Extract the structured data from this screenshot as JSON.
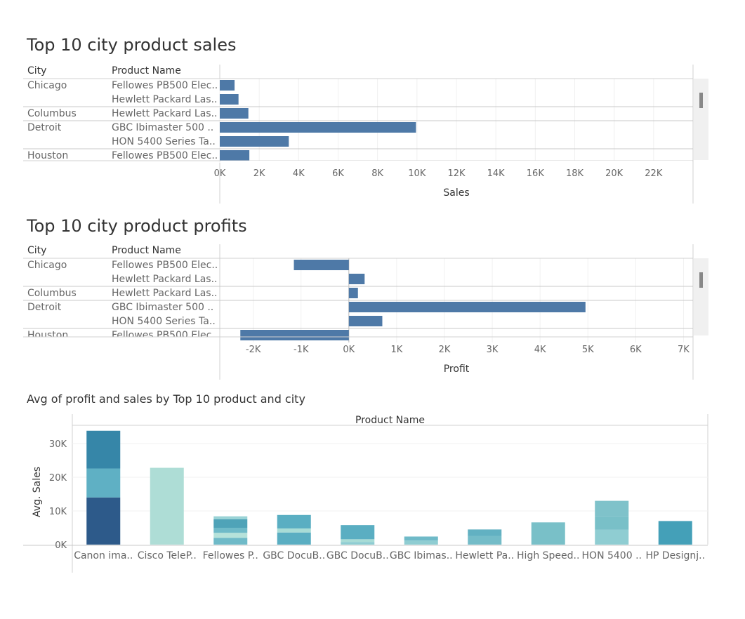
{
  "sales_panel": {
    "title": "Top 10 city product sales",
    "col_city": "City",
    "col_product": "Product Name"
  },
  "profit_panel": {
    "title": "Top 10 city product profits",
    "col_city": "City",
    "col_product": "Product Name"
  },
  "avg_panel": {
    "title": "Avg of profit and sales by Top 10 product and city",
    "header": "Product Name"
  },
  "colors": {
    "bar": "#4e79a7",
    "scrollbar_track": "#f0f0f0",
    "scrollbar_thumb": "#888888",
    "grid": "#eeeeee",
    "divider": "#d0d0d0"
  },
  "chart_data": [
    {
      "type": "bar",
      "orientation": "horizontal",
      "title": "Top 10 city product sales",
      "xlabel": "Sales",
      "xlim": [
        0,
        24000
      ],
      "ticks": [
        "0K",
        "2K",
        "4K",
        "6K",
        "8K",
        "10K",
        "12K",
        "14K",
        "16K",
        "18K",
        "20K",
        "22K"
      ],
      "tick_values": [
        0,
        2000,
        4000,
        6000,
        8000,
        10000,
        12000,
        14000,
        16000,
        18000,
        20000,
        22000
      ],
      "rows": [
        {
          "city": "Chicago",
          "product": "Fellowes PB500 Elec..",
          "value": 750
        },
        {
          "city": "",
          "product": "Hewlett Packard Las..",
          "value": 950
        },
        {
          "city": "Columbus",
          "product": "Hewlett Packard Las..",
          "value": 1450
        },
        {
          "city": "Detroit",
          "product": "GBC Ibimaster 500 ..",
          "value": 9950
        },
        {
          "city": "",
          "product": "HON 5400 Series Ta..",
          "value": 3500
        },
        {
          "city": "Houston",
          "product": "Fellowes PB500 Elec..",
          "value": 1500
        }
      ]
    },
    {
      "type": "bar",
      "orientation": "horizontal",
      "title": "Top 10 city product profits",
      "xlabel": "Profit",
      "xlim": [
        -2700,
        7200
      ],
      "ticks": [
        "-2K",
        "-1K",
        "0K",
        "1K",
        "2K",
        "3K",
        "4K",
        "5K",
        "6K",
        "7K"
      ],
      "tick_values": [
        -2000,
        -1000,
        0,
        1000,
        2000,
        3000,
        4000,
        5000,
        6000,
        7000
      ],
      "rows": [
        {
          "city": "Chicago",
          "product": "Fellowes PB500 Elec..",
          "value": -1150
        },
        {
          "city": "",
          "product": "Hewlett Packard Las..",
          "value": 330
        },
        {
          "city": "Columbus",
          "product": "Hewlett Packard Las..",
          "value": 190
        },
        {
          "city": "Detroit",
          "product": "GBC Ibimaster 500 ..",
          "value": 4950
        },
        {
          "city": "",
          "product": "HON 5400 Series Ta..",
          "value": 700
        },
        {
          "city": "Houston",
          "product": "Fellowes PB500 Elec..",
          "value": -2270
        }
      ]
    },
    {
      "type": "bar",
      "stacked": true,
      "title": "Avg of profit and sales by Top 10 product and city",
      "ylabel": "Avg. Sales",
      "xlabel": "Product Name",
      "ylim": [
        -2000,
        36000
      ],
      "ticks": [
        "0K",
        "10K",
        "20K",
        "30K"
      ],
      "tick_values": [
        0,
        10000,
        20000,
        30000
      ],
      "categories": [
        "Canon ima..",
        "Cisco TeleP..",
        "Fellowes P..",
        "GBC DocuB..",
        "GBC DocuB..",
        "GBC Ibimas..",
        "Hewlett Pa..",
        "High Speed..",
        "HON 5400 ..",
        "HP Designj.."
      ],
      "stacks": [
        [
          {
            "value": 14000,
            "color": "#2d5a8a"
          },
          {
            "value": 8600,
            "color": "#5fb0c4"
          },
          {
            "value": 11200,
            "color": "#3686a8"
          }
        ],
        [
          {
            "value": 22800,
            "color": "#aeddd6"
          }
        ],
        [
          {
            "value": 2000,
            "color": "#6fbac8"
          },
          {
            "value": 1500,
            "color": "#b6e2da"
          },
          {
            "value": 1500,
            "color": "#6fbac8"
          },
          {
            "value": 2500,
            "color": "#4fa3b8"
          },
          {
            "value": 900,
            "color": "#9ad3d6"
          }
        ],
        [
          {
            "value": 3600,
            "color": "#5aaec2"
          },
          {
            "value": 1200,
            "color": "#a8dcd6"
          },
          {
            "value": 4000,
            "color": "#5aaec2"
          }
        ],
        [
          {
            "value": 800,
            "color": "#8fcdd2"
          },
          {
            "value": 800,
            "color": "#a8dcd6"
          },
          {
            "value": 4200,
            "color": "#5aaec2"
          }
        ],
        [
          {
            "value": 1200,
            "color": "#8fcdd2"
          },
          {
            "value": 1200,
            "color": "#6fbac8"
          }
        ],
        [
          {
            "value": 2600,
            "color": "#74bcc8"
          },
          {
            "value": 1900,
            "color": "#62b1c2"
          }
        ],
        [
          {
            "value": 6600,
            "color": "#79c0c8"
          }
        ],
        [
          {
            "value": 4400,
            "color": "#8fcdd2"
          },
          {
            "value": 4000,
            "color": "#79c0c8"
          },
          {
            "value": 4600,
            "color": "#7fc2ca"
          }
        ],
        [
          {
            "value": 7000,
            "color": "#44a0b8"
          }
        ]
      ]
    }
  ]
}
